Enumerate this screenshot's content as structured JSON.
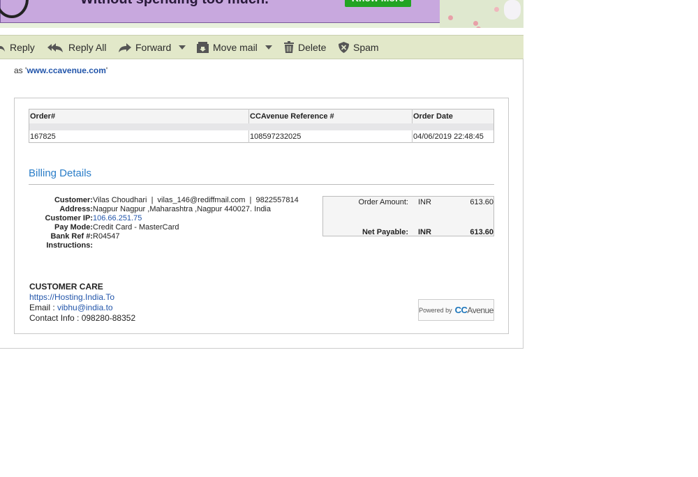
{
  "banner": {
    "text": "Without spending too much.",
    "cta": "Know More"
  },
  "toolbar": {
    "reply": "Reply",
    "reply_all": "Reply All",
    "forward": "Forward",
    "move_mail": "Move mail",
    "delete": "Delete",
    "spam": "Spam"
  },
  "intro": {
    "prefix": "as '",
    "link": "www.ccavenue.com",
    "suffix": "'"
  },
  "order_table": {
    "headers": [
      "Order#",
      "CCAvenue Reference #",
      "Order Date"
    ],
    "row": [
      "167825",
      "108597232025",
      "04/06/2019 22:48:45"
    ]
  },
  "billing": {
    "title": "Billing Details",
    "customer_label": "Customer:",
    "customer_value": "Vilas Choudhari  |  vilas_146@rediffmail.com  |  9822557814",
    "address_label": "Address:",
    "address_value": "Nagpur Nagpur ,Maharashtra ,Nagpur 440027. India",
    "ip_label": "Customer IP:",
    "ip_value": "106.66.251.75",
    "paymode_label": "Pay Mode:",
    "paymode_value": "Credit Card - MasterCard",
    "bankref_label": "Bank Ref #:",
    "bankref_value": "R04547",
    "instructions_label": "Instructions:",
    "instructions_value": ""
  },
  "amounts": {
    "order_amount_label": "Order Amount:",
    "order_amount_currency": "INR",
    "order_amount_value": "613.60",
    "net_payable_label": "Net Payable:",
    "net_payable_currency": "INR",
    "net_payable_value": "613.60"
  },
  "customer_care": {
    "title": "CUSTOMER CARE",
    "website": "https://Hosting.India.To",
    "email_label": "Email : ",
    "email": "vibhu@india.to",
    "contact": "Contact Info : 098280-88352"
  },
  "powered_by": {
    "label": "Powered by",
    "brand_cc": "CC",
    "brand_avenue": "Avenue"
  }
}
